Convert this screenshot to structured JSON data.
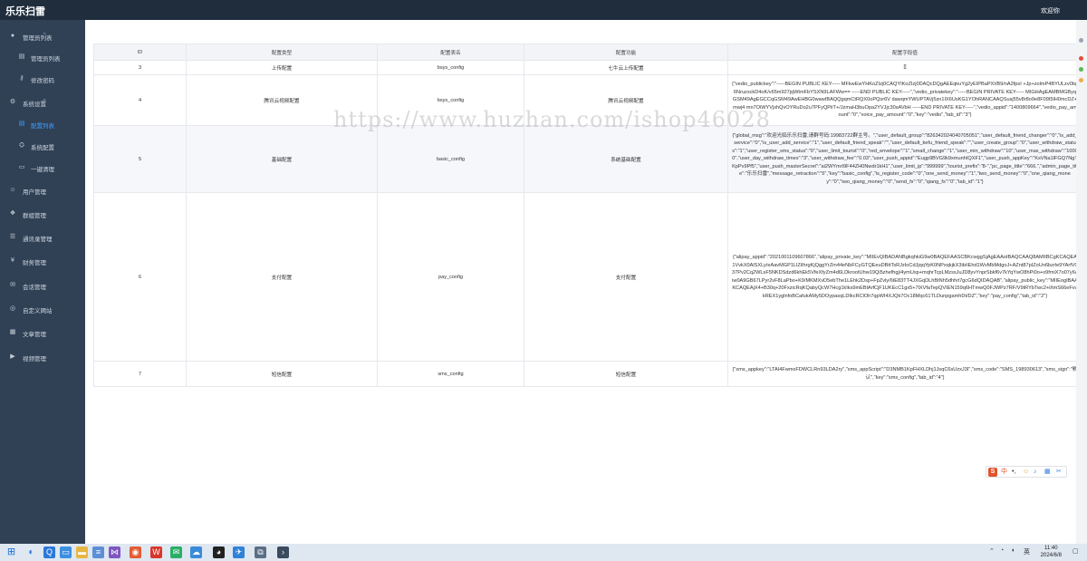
{
  "app": {
    "brand": "乐乐扫雷",
    "welcome": "欢迎你"
  },
  "sidebar": {
    "items": [
      {
        "label": "管理员列表",
        "icon": "user-icon",
        "kind": "group",
        "arrow": "⌃"
      },
      {
        "label": "管理员列表",
        "icon": "list-icon",
        "kind": "sub"
      },
      {
        "label": "修改密码",
        "icon": "key-icon",
        "kind": "sub"
      },
      {
        "label": "系统设置",
        "icon": "gear-icon",
        "kind": "group",
        "arrow": "⌃"
      },
      {
        "label": "配置列表",
        "icon": "list-icon",
        "kind": "sub",
        "active": true
      },
      {
        "label": "系统配置",
        "icon": "settings-icon",
        "kind": "sub"
      },
      {
        "label": "一键清理",
        "icon": "clean-icon",
        "kind": "sub"
      },
      {
        "label": "用户管理",
        "icon": "users-icon",
        "kind": "group",
        "arrow": "⌄"
      },
      {
        "label": "群组管理",
        "icon": "group-icon",
        "kind": "group",
        "arrow": "⌄"
      },
      {
        "label": "通讯录管理",
        "icon": "contacts-icon",
        "kind": "group",
        "arrow": "⌄"
      },
      {
        "label": "财务管理",
        "icon": "finance-icon",
        "kind": "group",
        "arrow": "⌄"
      },
      {
        "label": "会话管理",
        "icon": "chat-icon",
        "kind": "group",
        "arrow": "⌄"
      },
      {
        "label": "自定义网站",
        "icon": "globe-icon",
        "kind": "group",
        "arrow": "⌄"
      },
      {
        "label": "文章管理",
        "icon": "article-icon",
        "kind": "group",
        "arrow": "⌄"
      },
      {
        "label": "视频管理",
        "icon": "video-icon",
        "kind": "group",
        "arrow": "⌄"
      }
    ]
  },
  "table": {
    "headers": [
      "ID",
      "配置类型",
      "配置表名",
      "配置功能",
      "配置字段值"
    ],
    "rows": [
      {
        "id": "3",
        "type": "上传配置",
        "table": "bsys_config",
        "func": "七牛云上传配置",
        "value": "[]"
      },
      {
        "id": "4",
        "type": "腾讯云视频配置",
        "table": "bsys_config",
        "func": "腾讯云视频配置",
        "value": "{\"vedio_publickey\":\"-----BEGIN PUBLIC KEY----- MFkwEwYHKoZIzj0CAQYIKoZIzj0DAQcDQgAEEqkuYg2yEIPBaPXI/B9/nA2fpsI +Jp+zolmP4BYULzv0bg6NruzxckD4oK/v65m927jqWtmFbYSXN9LAFWw== -----END PUBLIC KEY-----\",\"vedio_privatekey\":\"-----BEGIN PRIVATE KEY----- MIGHAgEAMBMGByqGSM49AgEGCCqGSM49AwEHBG0wawIBAQQgqmCtRQX0oPQsr6V dawqmYWUPTA\\/j5zn1IX6UsKG1YOhRANCAAQSusj55v8r8o9e8F09I5lH0mcDZ+mwj4 mn7OiWYVjxhQvOYRuDo2u7PFyQPiiT+/JzmaH3buOpa2YVJjc30sAVbH -----END PRIVATE KEY-----\",\"vedio_appid\":\"1400809664\",\"vedio_pay_amount\":\"0\",\"voice_pay_amount\":\"0\",\"key\":\"vedio\",\"tab_id\":\"3\"}"
      },
      {
        "id": "5",
        "type": "基础配置",
        "table": "basic_config",
        "func": "系统基础配置",
        "value": "{\"global_msg\":\"欢迎光临乐乐扫雷,请群号码:19983722群主号。\",\"user_default_group\":\"826342024040705051\",\"user_default_friend_changer\":\"0\",\"is_add_service\":\"0\",\"is_user_add_service\":\"1\",\"user_default_friend_speak\":\"\",\"user_default_kefu_friend_speak\":\"\",\"user_create_group\":\"0\",\"user_withdraw_status\":\"1\",\"user_register_sms_status\":\"0\",\"user_limit_tourist\":\"0\",\"red_envelope\":\"1\",\"small_change\":\"1\",\"user_min_withdraw\":\"10\",\"user_max_withdraw\":\"10000\",\"user_day_withdraw_times\":\"3\",\"user_withdraw_fee\":\"0.03\",\"user_push_appid\":\"Eugp9BVG9k9xmunhIQXF1\",\"user_push_appKey\":\"KsVNa1lFGQ7NgTKpPv9Pf5\",\"user_push_masterSecret\":\"ai2WYmrI9F44ZH0Nwdr1kH1\",\"user_limit_ip\":\"999999\",\"tourist_prefix\":\"8-\",\"pc_page_title\":\"666.\",\"admin_page_title\":\"乐乐扫雷\",\"message_retraction\":\"5\",\"key\":\"basic_config\",\"is_register_code\":\"0\",\"one_send_money\":\"1\",\"two_send_money\":\"0\",\"one_qiang_money\":\"0\",\"two_qiang_money\":\"0\",\"send_fs\":\"0\",\"qiang_fs\":\"0\",\"tab_id\":\"1\"}"
      },
      {
        "id": "6",
        "type": "支付配置",
        "table": "pay_config",
        "func": "支付配置",
        "value": "{\"alipay_appid\":\"2021001109607866\",\"alipay_private_key\":\"MIIEvQIBADANBgkqhkiG9w0BAQEFAASCBKcwggSjAgEAAoIBAQCAAQ8AMIIBCgKCAQEA1VvkX0AlSXLy/eAavMGP1LlZiIhrgKjQggYrZm44eNbFCyGTQEeuDBttTsRJzIoCdJjqqYpK0NPxqkjkX3ib/iEhd1WvMbMdgoJ+AZnt87pIZoUn6bzrle9YArfV037Pv2Cq2WLsF5NKDSdzd6khEk5VfeXfyZm4d6LDkrootUhw19Qi5zhefhgj/4ymUsp+mqhrTcpLMzssJuJD8yvYnprSbkf6v7kYqYwO8hPi0o+o9fmiX7o07y6aiw0A9GB67LPyr2vF8LaPbo+K9/MKMXvD5ebThe1LEhk2Dsp+FpZvly/6tE83TT4JXGqDLhBtNh5dhfvt7gcG6dQIDAQAB\",\"alipay_public_key\":\"MIIEogIBAAKCAQEAjX4+B30q+20FxzicRqKQabyQcW7Hcg1kIks9mEBlArfCjF1UKEcC1gx5+7lXVfaTepQVIEN159q6HTmwQ0FJWPz7RF/V9tRYbTwc2+l/tmS66eFvukREX1yglnfoBCafukAMy5DOypasqLDIkcRClOh7qpWI4XJQk7Oc18Mqc61TLDunpgamhDt/DZ\",\"key\":\"pay_config\",\"tab_id\":\"2\"}"
      },
      {
        "id": "7",
        "type": "短信配置",
        "table": "sms_config",
        "func": "短信配置",
        "value": "{\"sms_appkey\":\"LTAI4FwmxFDWCLRn93LDA2ry\",\"sms_appScript\":\"D3NMB1KpFHXLDhj1JsqC6sUzxJ3I\",\"sms_code\":\"SMS_198930613\",\"sms_sign\":\"默认\",\"key\":\"sms_config\",\"tab_id\":\"4\"}"
      }
    ]
  },
  "watermark": "https://www.huzhan.com/ishop46028",
  "taskbar": {
    "time": "11:40",
    "date": "2024/6/8"
  },
  "colors": {
    "sidebar_bg": "#304156",
    "topbar_bg": "#1f2d3d",
    "active": "#409eff"
  }
}
